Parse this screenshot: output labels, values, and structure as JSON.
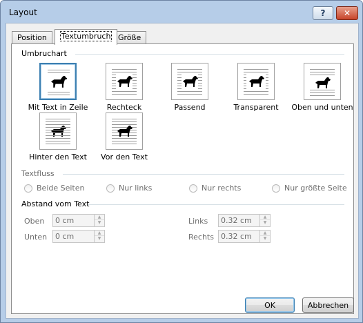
{
  "window": {
    "title": "Layout"
  },
  "title_buttons": {
    "help": "?",
    "close": "✕"
  },
  "tabs": [
    {
      "label": "Position"
    },
    {
      "label": "Textumbruch"
    },
    {
      "label": "Größe"
    }
  ],
  "wrap": {
    "heading": "Umbruchart",
    "options": [
      {
        "label": "Mit Text in Zeile",
        "selected": true
      },
      {
        "label": "Rechteck"
      },
      {
        "label": "Passend"
      },
      {
        "label": "Transparent"
      },
      {
        "label": "Oben und unten"
      },
      {
        "label": "Hinter den Text"
      },
      {
        "label": "Vor den Text"
      }
    ]
  },
  "textfluss": {
    "heading": "Textfluss",
    "options": [
      {
        "label": "Beide Seiten"
      },
      {
        "label": "Nur links"
      },
      {
        "label": "Nur rechts"
      },
      {
        "label": "Nur größte Seite"
      }
    ]
  },
  "abstand": {
    "heading": "Abstand vom Text",
    "oben_label": "Oben",
    "oben_value": "0 cm",
    "unten_label": "Unten",
    "unten_value": "0 cm",
    "links_label": "Links",
    "links_value": "0.32 cm",
    "rechts_label": "Rechts",
    "rechts_value": "0.32 cm"
  },
  "buttons": {
    "ok": "OK",
    "cancel": "Abbrechen"
  },
  "colors": {
    "accent": "#3c7fb1",
    "title_bg": "#b6cde8",
    "close": "#c7442a"
  }
}
